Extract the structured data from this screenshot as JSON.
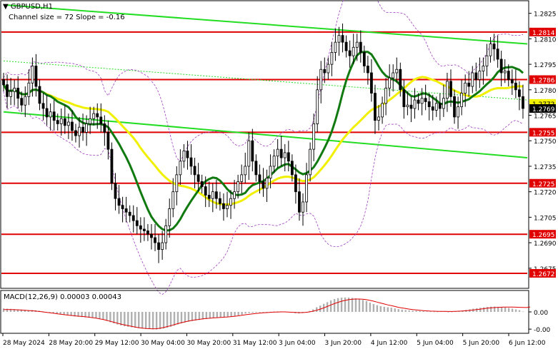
{
  "header": {
    "symbol_label": "GBPUSD,H1",
    "channel_label": "Channel size = 72  Slope = -0.16"
  },
  "macd_label": "MACD(12,26,9) 0.00003 0.00043",
  "colors": {
    "up_candle": "#000000",
    "down_candle": "#000000",
    "level_line": "#e00000",
    "level_label_bg": "#e00000",
    "channel": "#22dd22",
    "ma_fast": "#f0f000",
    "ma_slow": "#107a10",
    "bollinger": "#a040c0",
    "macd_hist": "#b0b0b0",
    "macd_signal": "#e00000",
    "price_label_bg": "#000000"
  },
  "chart_data": [
    {
      "type": "candlestick",
      "title": "GBPUSD,H1",
      "annotation": "Channel size = 72  Slope = -0.16",
      "ylim": [
        1.2664,
        1.2832
      ],
      "y_ticks": [
        "1.2825",
        "1.2810",
        "1.2795",
        "1.2780",
        "1.2765",
        "1.2750",
        "1.2735",
        "1.2720",
        "1.2705",
        "1.2690",
        "1.2675"
      ],
      "x_ticks": [
        "28 May 2024",
        "28 May 20:00",
        "29 May 12:00",
        "30 May 04:00",
        "30 May 20:00",
        "31 May 12:00",
        "3 Jun 04:00",
        "3 Jun 20:00",
        "4 Jun 12:00",
        "5 Jun 04:00",
        "5 Jun 20:00",
        "6 Jun 12:00"
      ],
      "close": [
        1.2783,
        1.2776,
        1.2779,
        1.2781,
        1.2775,
        1.2771,
        1.2776,
        1.2784,
        1.2794,
        1.2782,
        1.2772,
        1.2769,
        1.2764,
        1.2767,
        1.2762,
        1.276,
        1.2763,
        1.2759,
        1.2761,
        1.2756,
        1.2753,
        1.2758,
        1.2755,
        1.276,
        1.2763,
        1.2766,
        1.2764,
        1.276,
        1.2755,
        1.2745,
        1.2725,
        1.2716,
        1.2712,
        1.271,
        1.2708,
        1.2706,
        1.2703,
        1.27,
        1.2698,
        1.2697,
        1.2695,
        1.2693,
        1.269,
        1.2686,
        1.269,
        1.27,
        1.271,
        1.272,
        1.273,
        1.2738,
        1.2744,
        1.274,
        1.2735,
        1.273,
        1.2726,
        1.2723,
        1.2718,
        1.2716,
        1.272,
        1.2716,
        1.2713,
        1.271,
        1.2712,
        1.2716,
        1.272,
        1.2726,
        1.273,
        1.2735,
        1.275,
        1.2738,
        1.273,
        1.2726,
        1.2722,
        1.2728,
        1.2735,
        1.2741,
        1.2745,
        1.274,
        1.2743,
        1.2738,
        1.273,
        1.272,
        1.2708,
        1.2714,
        1.273,
        1.2745,
        1.276,
        1.278,
        1.2792,
        1.279,
        1.2795,
        1.2802,
        1.2808,
        1.2812,
        1.2808,
        1.2803,
        1.28,
        1.2805,
        1.2808,
        1.2802,
        1.2794,
        1.279,
        1.2778,
        1.2762,
        1.2764,
        1.2772,
        1.2781,
        1.2787,
        1.279,
        1.2792,
        1.278,
        1.277,
        1.2771,
        1.2769,
        1.2774,
        1.2772,
        1.2775,
        1.2773,
        1.277,
        1.2768,
        1.2772,
        1.2769,
        1.2775,
        1.2785,
        1.2776,
        1.2764,
        1.277,
        1.2778,
        1.2784,
        1.2782,
        1.279,
        1.2786,
        1.2791,
        1.2794,
        1.28,
        1.2807,
        1.2804,
        1.2798,
        1.279,
        1.2791,
        1.2786,
        1.2784,
        1.278,
        1.2776,
        1.2769
      ],
      "series": [
        {
          "name": "",
          "role": "channel-upper",
          "from": [
            1.283,
            0
          ],
          "to": [
            1.2807,
            150
          ]
        },
        {
          "name": "",
          "role": "channel-lower",
          "from": [
            1.2767,
            0
          ],
          "to": [
            1.274,
            150
          ]
        },
        {
          "name": "",
          "role": "channel-mid",
          "from": [
            1.2797,
            0
          ],
          "to": [
            1.2774,
            150
          ]
        }
      ],
      "horizontal_levels": [
        1.2814,
        1.2786,
        1.2755,
        1.2725,
        1.2695,
        1.2672
      ],
      "price_labels": [
        {
          "text": "1.2814",
          "value": 1.2814,
          "style": "level"
        },
        {
          "text": "1.2786",
          "value": 1.2786,
          "style": "level"
        },
        {
          "text": "1.2772",
          "value": 1.2772,
          "style": "ma"
        },
        {
          "text": "1.2769",
          "value": 1.2769,
          "style": "price"
        },
        {
          "text": "1.2755",
          "value": 1.2755,
          "style": "level"
        },
        {
          "text": "1.2725",
          "value": 1.2725,
          "style": "level"
        },
        {
          "text": "1.2695",
          "value": 1.2695,
          "style": "level"
        },
        {
          "text": "1.2672",
          "value": 1.2672,
          "style": "level"
        }
      ],
      "grid": false
    },
    {
      "type": "bar",
      "title": "MACD(12,26,9) 0.00003 0.00043",
      "ylim": [
        -0.0018,
        0.0018
      ],
      "y_ticks": [
        "0.00",
        "-0.00"
      ],
      "histogram": [
        0.0003,
        0.00028,
        0.00026,
        0.00024,
        0.00022,
        0.0002,
        0.00018,
        0.00015,
        0.00016,
        0.00014,
        0.0001,
        5e-05,
        0.0,
        -5e-05,
        -0.0001,
        -0.00015,
        -0.0002,
        -0.00025,
        -0.0003,
        -0.00035,
        -0.0004,
        -0.00042,
        -0.00045,
        -0.00048,
        -0.0005,
        -0.00052,
        -0.00055,
        -0.0006,
        -0.00068,
        -0.00078,
        -0.0009,
        -0.001,
        -0.0011,
        -0.00118,
        -0.00125,
        -0.0013,
        -0.00134,
        -0.00138,
        -0.00142,
        -0.00145,
        -0.00148,
        -0.0015,
        -0.00152,
        -0.00153,
        -0.0015,
        -0.00145,
        -0.00138,
        -0.0013,
        -0.0012,
        -0.0011,
        -0.001,
        -0.00092,
        -0.00085,
        -0.0008,
        -0.00075,
        -0.0007,
        -0.00066,
        -0.00062,
        -0.00058,
        -0.00055,
        -0.00052,
        -0.0005,
        -0.00048,
        -0.00044,
        -0.0004,
        -0.00036,
        -0.0003,
        -0.00024,
        -0.00015,
        -0.0001,
        -8e-05,
        -6e-05,
        -5e-05,
        -3e-05,
        -1e-05,
        1e-05,
        3e-05,
        4e-05,
        4e-05,
        2e-05,
        -2e-05,
        -6e-05,
        -0.00012,
        -0.00014,
        -0.0001,
        -3e-05,
        8e-05,
        0.00022,
        0.0004,
        0.00055,
        0.0007,
        0.00085,
        0.001,
        0.00112,
        0.0012,
        0.00124,
        0.00125,
        0.00124,
        0.00122,
        0.00118,
        0.00112,
        0.00104,
        0.00094,
        0.0008,
        0.00068,
        0.00058,
        0.0005,
        0.00044,
        0.0004,
        0.00036,
        0.0003,
        0.00024,
        0.0002,
        0.00016,
        0.00013,
        0.00011,
        0.0001,
        8e-05,
        6e-05,
        4e-05,
        3e-05,
        2e-05,
        2e-05,
        4e-05,
        4e-05,
        0.0,
        1e-05,
        4e-05,
        8e-05,
        0.00012,
        0.00018,
        0.00022,
        0.00028,
        0.00032,
        0.00036,
        0.0004,
        0.00043,
        0.00046,
        0.00046,
        0.00044,
        0.00042,
        0.00038,
        0.00034,
        0.00028,
        0.00022,
        0.00015,
        3e-05
      ],
      "signal": [
        0.0002,
        0.0002,
        0.0002,
        0.00019,
        0.00018,
        0.00016,
        0.00014,
        0.00012,
        0.0001,
        7e-05,
        4e-05,
        0.0,
        -4e-05,
        -8e-05,
        -0.00012,
        -0.00016,
        -0.0002,
        -0.00024,
        -0.00028,
        -0.00031,
        -0.00034,
        -0.00037,
        -0.0004,
        -0.00043,
        -0.00046,
        -0.0005,
        -0.00054,
        -0.0006,
        -0.00066,
        -0.00074,
        -0.00082,
        -0.0009,
        -0.00098,
        -0.00106,
        -0.00113,
        -0.0012,
        -0.00126,
        -0.00132,
        -0.00137,
        -0.00141,
        -0.00144,
        -0.00146,
        -0.00147,
        -0.00146,
        -0.00142,
        -0.00136,
        -0.00128,
        -0.0012,
        -0.00111,
        -0.00102,
        -0.00094,
        -0.00086,
        -0.0008,
        -0.00074,
        -0.00069,
        -0.00065,
        -0.00061,
        -0.00058,
        -0.00055,
        -0.00052,
        -0.0005,
        -0.00048,
        -0.00046,
        -0.00044,
        -0.00041,
        -0.00038,
        -0.00034,
        -0.0003,
        -0.00025,
        -0.00021,
        -0.00017,
        -0.00014,
        -0.00011,
        -8e-05,
        -6e-05,
        -4e-05,
        -2e-05,
        -1e-05,
        0.0,
        0.0,
        -1e-05,
        -3e-05,
        -5e-05,
        -6e-05,
        -6e-05,
        -4e-05,
        0.0,
        6e-05,
        0.00014,
        0.00024,
        0.00035,
        0.00047,
        0.0006,
        0.00072,
        0.00083,
        0.00093,
        0.001,
        0.00106,
        0.0011,
        0.00112,
        0.00112,
        0.0011,
        0.00106,
        0.001,
        0.00093,
        0.00085,
        0.00077,
        0.00069,
        0.00061,
        0.00054,
        0.00047,
        0.0004,
        0.00034,
        0.00029,
        0.00024,
        0.0002,
        0.00017,
        0.00014,
        0.00011,
        9e-05,
        7e-05,
        6e-05,
        5e-05,
        5e-05,
        5e-05,
        4e-05,
        4e-05,
        5e-05,
        6e-05,
        8e-05,
        0.0001,
        0.00013,
        0.00016,
        0.0002,
        0.00024,
        0.00028,
        0.00032,
        0.00035,
        0.00038,
        0.0004,
        0.00041,
        0.00042,
        0.00042,
        0.00042,
        0.00041,
        0.0004,
        0.00039,
        0.00038,
        0.00043
      ]
    }
  ]
}
